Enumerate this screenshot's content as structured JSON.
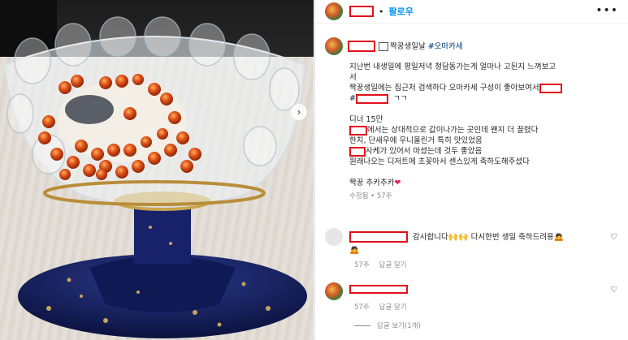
{
  "header": {
    "dot": "•",
    "follow_label": "팔로우",
    "more_icon": "•••"
  },
  "caption": {
    "title_suffix": "짝꿍생일날",
    "hashtag": "#오마카세",
    "lines": [
      "지난번 내생일에 평일저녁 청담동가는게 얼마나 고된지 느껴보고",
      "서",
      "짝꿍생일에는 집근처 검색하다 오마카세 구성이 좋아보여서"
    ],
    "hash_prefix": "#",
    "hash_suffix": "ㄱㄱ",
    "dinner": "디너 15만",
    "line_a_suffix": "에서는 상대적으로 값이나가는 곳인데 왠지 더 끌렸다",
    "line_b": "한치, 단새우에 우니올린거 특히 맛있었음",
    "line_c_suffix": "사케가 있어서 마셨는데 것두 좋았음",
    "line_d": "원래나오는 디저트에 초꽂아서 센스있게 축하도해주셨다",
    "closing": "짝꿍 추카추카",
    "heart_emoji": "❤",
    "edited": "수정됨",
    "dot": "•",
    "age": "57주"
  },
  "comments": [
    {
      "text_a": "감사합니다",
      "emoji_a": "🙌🙌",
      "text_b": "다시한번 생일 축하드려용",
      "emoji_b": "🙇",
      "extra_emoji": "🙇",
      "age": "57주",
      "reply": "답글 달기"
    },
    {
      "age": "57주",
      "reply": "답글 달기"
    }
  ],
  "view_replies": "답글 보기(1개)",
  "icons": {
    "photo_next": "chevron-right-icon",
    "like": "heart-icon"
  }
}
